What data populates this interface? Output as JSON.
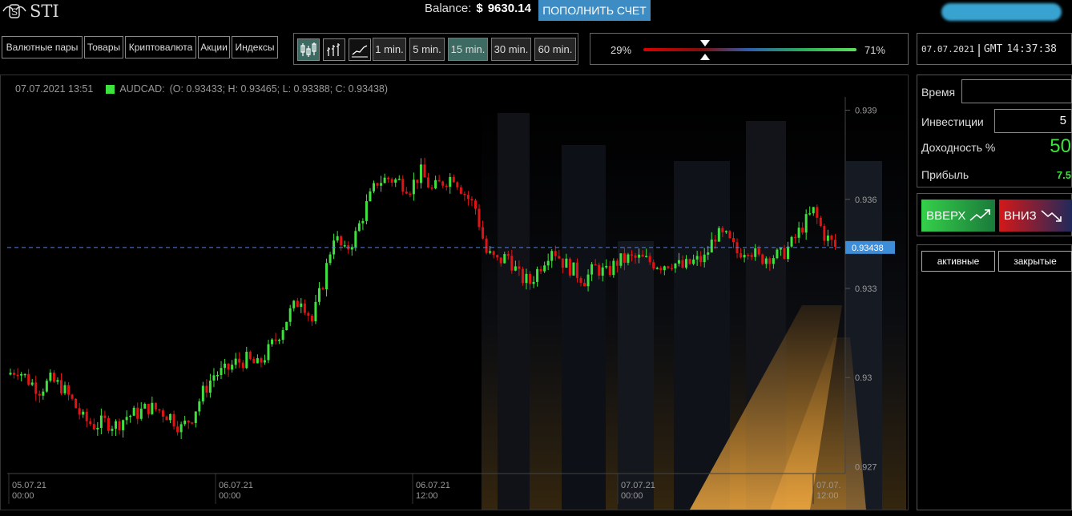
{
  "header": {
    "logo_text": "STI",
    "balance_label": "Balance:",
    "balance_currency": "$",
    "balance_value": "9630.14",
    "topup_label": "ПОПОЛНИТЬ СЧЕТ"
  },
  "categories": [
    "Валютные пары",
    "Товары",
    "Криптовалюта",
    "Акции",
    "Индексы"
  ],
  "chart_types": [
    "candlestick-icon",
    "bar-chart-icon",
    "line-chart-icon"
  ],
  "timeframes": [
    {
      "label": "1 min.",
      "active": false
    },
    {
      "label": "5 min.",
      "active": false
    },
    {
      "label": "15 min.",
      "active": true
    },
    {
      "label": "30 min.",
      "active": false
    },
    {
      "label": "60 min.",
      "active": false
    }
  ],
  "sentiment": {
    "down_pct": "29%",
    "up_pct": "71%",
    "marker_position": 0.29
  },
  "clock": {
    "date": "07.07.2021",
    "separator": "|",
    "zone": "GMT",
    "time": "14:37:38"
  },
  "ohlc": {
    "datetime": "07.07.2021 13:51",
    "symbol": "AUDCAD:",
    "text": "(O: 0.93433; H: 0.93465; L: 0.93388; C: 0.93438)"
  },
  "current_price": "0.93438",
  "trade": {
    "time_label": "Время",
    "time_value": "",
    "investment_label": "Инвестиции",
    "investment_value": "5",
    "yield_label": "Доходность %",
    "yield_value": "50",
    "profit_label": "Прибыль",
    "profit_value": "7.5",
    "up_label": "ВВЕРХ",
    "down_label": "ВНИЗ"
  },
  "orders": {
    "active_label": "активные",
    "closed_label": "закрытые"
  },
  "colors": {
    "bull": "#3ee23e",
    "bear": "#e01414",
    "accent": "#3d8dc4",
    "active_tf": "#3d6b64"
  },
  "chart_data": {
    "type": "candlestick",
    "symbol": "AUDCAD",
    "ylim": [
      0.9265,
      0.9395
    ],
    "y_ticks": [
      "0.939",
      "0.936",
      "0.933",
      "0.93",
      "0.927"
    ],
    "x_ticks": [
      {
        "line1": "05.07.21",
        "line2": "00:00"
      },
      {
        "line1": "06.07.21",
        "line2": "00:00"
      },
      {
        "line1": "06.07.21",
        "line2": "12:00"
      },
      {
        "line1": "07.07.21",
        "line2": "00:00"
      },
      {
        "line1": "07.07.",
        "line2": "12:00"
      }
    ],
    "last_price": 0.93438,
    "close_path": [
      0.9301,
      0.9303,
      0.9299,
      0.9296,
      0.9299,
      0.9297,
      0.9292,
      0.9286,
      0.9284,
      0.9285,
      0.9284,
      0.9287,
      0.9288,
      0.929,
      0.9289,
      0.9287,
      0.9283,
      0.9287,
      0.9295,
      0.9301,
      0.9302,
      0.9305,
      0.9306,
      0.9304,
      0.9309,
      0.9315,
      0.9322,
      0.9327,
      0.9319,
      0.9332,
      0.9348,
      0.9342,
      0.9348,
      0.9358,
      0.9366,
      0.9367,
      0.9366,
      0.9364,
      0.9369,
      0.9363,
      0.9366,
      0.9368,
      0.9362,
      0.9357,
      0.9342,
      0.9339,
      0.9341,
      0.9334,
      0.9332,
      0.9338,
      0.9344,
      0.9339,
      0.9336,
      0.9333,
      0.9337,
      0.9335,
      0.9339,
      0.934,
      0.934,
      0.9339,
      0.9338,
      0.9339,
      0.9337,
      0.9339,
      0.934,
      0.9348,
      0.9347,
      0.9342,
      0.9344,
      0.934,
      0.9341,
      0.9341,
      0.9345,
      0.9351,
      0.9356,
      0.9348,
      0.9344
    ]
  }
}
